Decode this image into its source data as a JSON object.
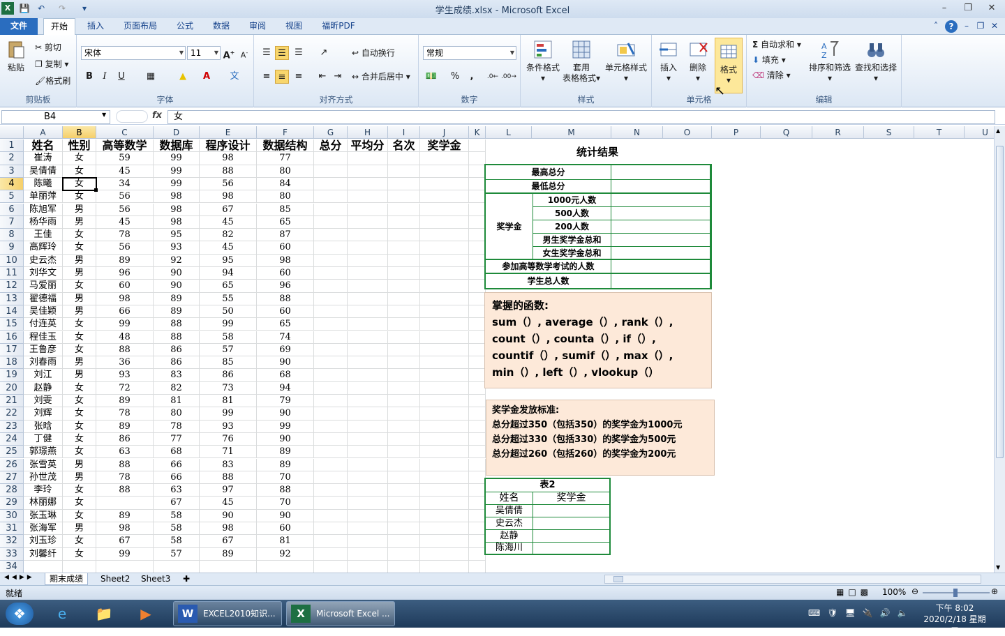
{
  "window": {
    "title": "学生成绩.xlsx - Microsoft Excel"
  },
  "tabs": [
    "文件",
    "开始",
    "插入",
    "页面布局",
    "公式",
    "数据",
    "审阅",
    "视图",
    "福昕PDF"
  ],
  "ribbon": {
    "clipboard": {
      "paste": "粘贴",
      "cut": "剪切",
      "copy": "复制",
      "format_painter": "格式刷",
      "label": "剪贴板"
    },
    "font": {
      "name": "宋体",
      "size": "11",
      "label": "字体",
      "bold": "B",
      "italic": "I",
      "underline": "U"
    },
    "align": {
      "wrap": "自动换行",
      "merge": "合并后居中",
      "label": "对齐方式"
    },
    "number": {
      "format": "常规",
      "label": "数字",
      "percent": "%",
      "comma": ","
    },
    "styles": {
      "conditional": "条件格式",
      "table_1": "套用",
      "table_2": "表格格式",
      "cell_styles": "单元格样式",
      "label": "样式"
    },
    "cells": {
      "insert": "插入",
      "delete": "删除",
      "format": "格式",
      "label": "单元格"
    },
    "editing": {
      "autosum": "自动求和",
      "fill": "填充",
      "clear": "清除",
      "sort": "排序和筛选",
      "find": "查找和选择",
      "label": "编辑"
    }
  },
  "formula_bar": {
    "name_box": "B4",
    "fx": "fx",
    "value": "女"
  },
  "columns": [
    "A",
    "B",
    "C",
    "D",
    "E",
    "F",
    "G",
    "H",
    "I",
    "J",
    "K",
    "L",
    "M",
    "N",
    "O",
    "P",
    "Q",
    "R",
    "S",
    "T",
    "U"
  ],
  "headers": [
    "姓名",
    "性别",
    "高等数学",
    "数据库",
    "程序设计",
    "数据结构",
    "总分",
    "平均分",
    "名次",
    "奖学金"
  ],
  "rows": [
    [
      "崔涛",
      "女",
      "59",
      "99",
      "98",
      "77"
    ],
    [
      "吴倩倩",
      "女",
      "45",
      "99",
      "88",
      "80"
    ],
    [
      "陈曦",
      "女",
      "34",
      "99",
      "56",
      "84"
    ],
    [
      "单丽萍",
      "女",
      "56",
      "98",
      "98",
      "80"
    ],
    [
      "陈旭军",
      "男",
      "56",
      "98",
      "67",
      "85"
    ],
    [
      "杨华雨",
      "男",
      "45",
      "98",
      "45",
      "65"
    ],
    [
      "王佳",
      "女",
      "78",
      "95",
      "82",
      "87"
    ],
    [
      "高辉玲",
      "女",
      "56",
      "93",
      "45",
      "60"
    ],
    [
      "史云杰",
      "男",
      "89",
      "92",
      "95",
      "98"
    ],
    [
      "刘华文",
      "男",
      "96",
      "90",
      "94",
      "60"
    ],
    [
      "马爱丽",
      "女",
      "60",
      "90",
      "65",
      "96"
    ],
    [
      "翟德福",
      "男",
      "98",
      "89",
      "55",
      "88"
    ],
    [
      "吴佳颖",
      "男",
      "66",
      "89",
      "50",
      "60"
    ],
    [
      "付连英",
      "女",
      "99",
      "88",
      "99",
      "65"
    ],
    [
      "程佳玉",
      "女",
      "48",
      "88",
      "58",
      "74"
    ],
    [
      "王鲁彦",
      "女",
      "88",
      "86",
      "57",
      "69"
    ],
    [
      "刘春雨",
      "男",
      "36",
      "86",
      "85",
      "90"
    ],
    [
      "刘江",
      "男",
      "93",
      "83",
      "86",
      "68"
    ],
    [
      "赵静",
      "女",
      "72",
      "82",
      "73",
      "94"
    ],
    [
      "刘雯",
      "女",
      "89",
      "81",
      "81",
      "79"
    ],
    [
      "刘辉",
      "女",
      "78",
      "80",
      "99",
      "90"
    ],
    [
      "张晗",
      "女",
      "89",
      "78",
      "93",
      "99"
    ],
    [
      "丁健",
      "女",
      "86",
      "77",
      "76",
      "90"
    ],
    [
      "郭璟燕",
      "女",
      "63",
      "68",
      "71",
      "89"
    ],
    [
      "张雪英",
      "男",
      "88",
      "66",
      "83",
      "89"
    ],
    [
      "孙世茂",
      "男",
      "78",
      "66",
      "88",
      "70"
    ],
    [
      "李玲",
      "女",
      "88",
      "63",
      "97",
      "88"
    ],
    [
      "林丽娜",
      "女",
      "",
      "67",
      "45",
      "70"
    ],
    [
      "张玉琳",
      "女",
      "89",
      "58",
      "90",
      "90"
    ],
    [
      "张海军",
      "男",
      "98",
      "58",
      "98",
      "60"
    ],
    [
      "刘玉珍",
      "女",
      "67",
      "58",
      "67",
      "81"
    ],
    [
      "刘馨纤",
      "女",
      "99",
      "57",
      "89",
      "92"
    ]
  ],
  "stats": {
    "title": "统计结果",
    "max_total": "最高总分",
    "min_total": "最低总分",
    "scholarship": "奖学金",
    "s1000": "1000元人数",
    "s500": "500人数",
    "s200": "200人数",
    "male_sum": "男生奖学金总和",
    "female_sum": "女生奖学金总和",
    "math_count": "参加高等数学考试的人数",
    "student_total": "学生总人数"
  },
  "functions_note": {
    "title": "掌握的函数:",
    "lines": [
      "sum（）, average（）, rank（）,",
      "count（）, counta（）, if（）,",
      "countif（）, sumif（）, max（）,",
      "min（）, left（）, vlookup（）"
    ]
  },
  "criteria_note": {
    "title": "奖学金发放标准:",
    "lines": [
      "总分超过350（包括350）的奖学金为1000元",
      "总分超过330（包括330）的奖学金为500元",
      "总分超过260（包括260）的奖学金为200元"
    ]
  },
  "table2": {
    "title": "表2",
    "col_name": "姓名",
    "col_award": "奖学金",
    "names": [
      "吴倩倩",
      "史云杰",
      "赵静",
      "陈海川"
    ]
  },
  "sheets": [
    "期末成绩",
    "Sheet2",
    "Sheet3"
  ],
  "status": {
    "ready": "就绪",
    "zoom": "100%"
  },
  "taskbar": {
    "word_app": "EXCEL2010知识...",
    "excel_app": "Microsoft Excel ...",
    "time": "下午 8:02",
    "date": "2020/2/18 星期二"
  }
}
